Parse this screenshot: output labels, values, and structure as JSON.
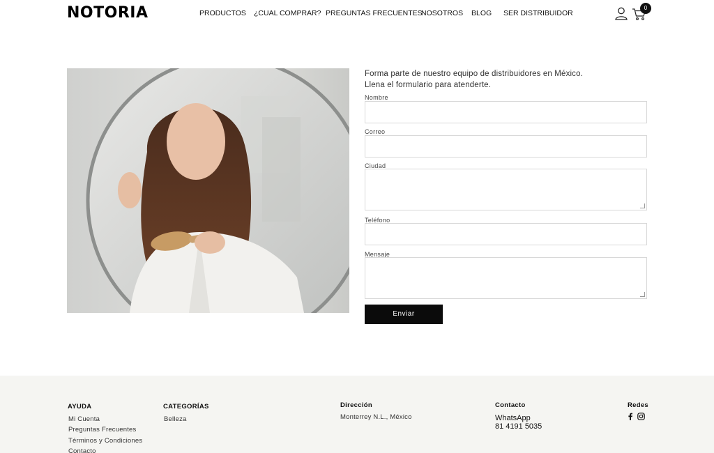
{
  "header": {
    "logo": "NOTORIA",
    "nav": [
      "PRODUCTOS",
      "¿CUAL COMPRAR?",
      "PREGUNTAS FRECUENTES",
      "NOSOTROS",
      "BLOG",
      "SER DISTRIBUIDOR"
    ],
    "cart_count": "0"
  },
  "hero": {
    "icon": "hero-photo"
  },
  "form": {
    "intro_line1": "Forma parte de nuestro equipo de distribuidores en México.",
    "intro_line2": "Llena el formulario para atenderte.",
    "fields": [
      "Nombre",
      "Correo",
      "Ciudad",
      "Teléfono",
      "Mensaje"
    ],
    "values": [
      "",
      "",
      "",
      "",
      ""
    ],
    "submit_label": "Enviar"
  },
  "footer": {
    "ayuda": {
      "title": "AYUDA",
      "links": [
        "Mi Cuenta",
        "Preguntas Frecuentes",
        "Términos y Condiciones",
        "Contacto"
      ]
    },
    "categorias": {
      "title": "CATEGORÍAS",
      "links": [
        "Belleza"
      ]
    },
    "direccion": {
      "title": "Dirección",
      "text": "Monterrey N.L., México"
    },
    "contacto": {
      "title": "Contacto",
      "label": "WhatsApp",
      "phone": "81 4191 5035"
    },
    "redes": {
      "title": "Redes",
      "icons": [
        "facebook-icon",
        "instagram-icon"
      ]
    }
  },
  "colors": {
    "accent": "#0b0b0b",
    "footer_bg": "#f5f5f2",
    "border": "#d8d8d8"
  }
}
